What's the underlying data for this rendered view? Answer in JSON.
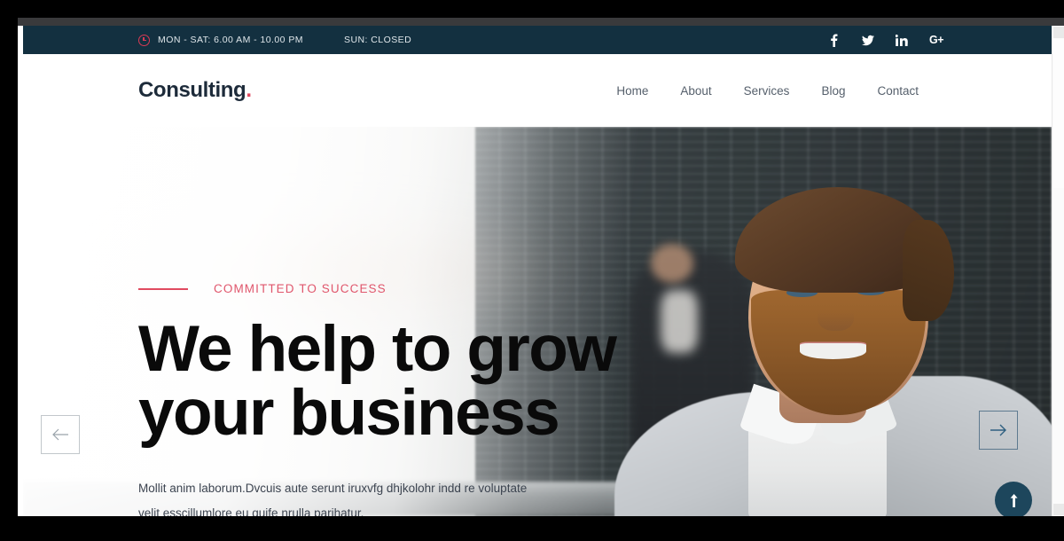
{
  "topbar": {
    "clock_icon": "clock-icon",
    "hours": "MON - SAT: 6.00 AM - 10.00 PM",
    "sunday": "SUN: CLOSED",
    "background_color": "#133040",
    "accent_color": "#d83a54",
    "social": [
      {
        "name": "facebook-icon",
        "label": "f"
      },
      {
        "name": "twitter-icon",
        "label": "t"
      },
      {
        "name": "linkedin-icon",
        "label": "in"
      },
      {
        "name": "google-plus-icon",
        "label": "G+"
      }
    ]
  },
  "header": {
    "logo_text": "Consulting",
    "logo_dot": ".",
    "logo_color": "#1d2b3a",
    "logo_dot_color": "#e04a60",
    "nav": [
      {
        "label": "Home"
      },
      {
        "label": "About"
      },
      {
        "label": "Services"
      },
      {
        "label": "Blog"
      },
      {
        "label": "Contact"
      }
    ]
  },
  "hero": {
    "eyebrow": "COMMITTED TO SUCCESS",
    "eyebrow_color": "#e0566c",
    "headline_line1": "We help to grow",
    "headline_line2": "your business",
    "paragraph_line1": "Mollit anim laborum.Dvcuis aute serunt iruxvfg dhjkolohr indd re voluptate",
    "paragraph_line2": "velit esscillumlore eu quife nrulla parihatur.",
    "prev_arrow_icon": "arrow-left-icon",
    "next_arrow_icon": "arrow-right-icon",
    "scroll_top_icon": "arrow-up-icon",
    "scroll_top_color": "#1d465c"
  },
  "scrollbar": {
    "up_icon": "scroll-up-arrow-icon",
    "down_icon": "scroll-down-arrow-icon"
  }
}
